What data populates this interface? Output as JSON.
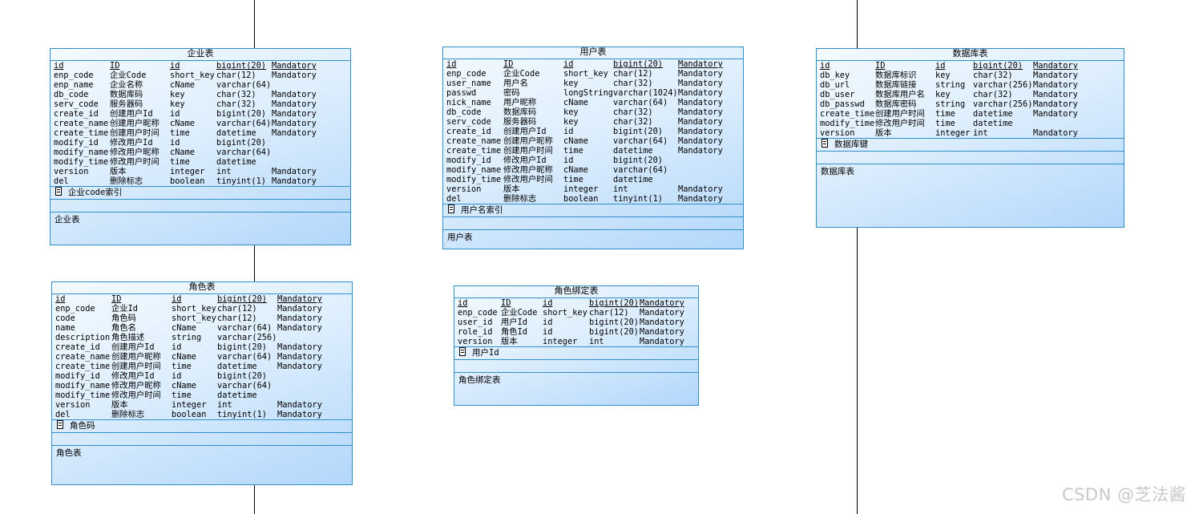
{
  "entities": [
    {
      "key": "enterprise",
      "title": "企业表",
      "header": [
        "id",
        "ID",
        "id",
        "bigint(20)",
        "Mandatory"
      ],
      "rows": [
        [
          "enp_code",
          "企业Code",
          "short_key",
          "char(12)",
          "Mandatory"
        ],
        [
          "enp_name",
          "企业名称",
          "cName",
          "varchar(64)",
          ""
        ],
        [
          "db_code",
          "数据库码",
          "key",
          "char(32)",
          "Mandatory"
        ],
        [
          "serv_code",
          "服务器码",
          "key",
          "char(32)",
          "Mandatory"
        ],
        [
          "create_id",
          "创建用户Id",
          "id",
          "bigint(20)",
          "Mandatory"
        ],
        [
          "create_name",
          "创建用户昵称",
          "cName",
          "varchar(64)",
          "Mandatory"
        ],
        [
          "create_time",
          "创建用户时间",
          "time",
          "datetime",
          "Mandatory"
        ],
        [
          "modify_id",
          "修改用户Id",
          "id",
          "bigint(20)",
          ""
        ],
        [
          "modify_name",
          "修改用户昵称",
          "cName",
          "varchar(64)",
          ""
        ],
        [
          "modify_time",
          "修改用户时间",
          "time",
          "datetime",
          ""
        ],
        [
          "version",
          "版本",
          "integer",
          "int",
          "Mandatory"
        ],
        [
          "del",
          "删除标志",
          "boolean",
          "tinyint(1)",
          "Mandatory"
        ]
      ],
      "index": "企业code索引",
      "comment": "企业表"
    },
    {
      "key": "user",
      "title": "用户表",
      "header": [
        "id",
        "ID",
        "id",
        "bigint(20)",
        "Mandatory"
      ],
      "rows": [
        [
          "enp_code",
          "企业Code",
          "short_key",
          "char(12)",
          "Mandatory"
        ],
        [
          "user_name",
          "用户名",
          "key",
          "char(32)",
          "Mandatory"
        ],
        [
          "passwd",
          "密码",
          "longString",
          "varchar(1024)",
          "Mandatory"
        ],
        [
          "nick_name",
          "用户昵称",
          "cName",
          "varchar(64)",
          "Mandatory"
        ],
        [
          "db_code",
          "数据库码",
          "key",
          "char(32)",
          "Mandatory"
        ],
        [
          "serv_code",
          "服务器码",
          "key",
          "char(32)",
          "Mandatory"
        ],
        [
          "create_id",
          "创建用户Id",
          "id",
          "bigint(20)",
          "Mandatory"
        ],
        [
          "create_name",
          "创建用户昵称",
          "cName",
          "varchar(64)",
          "Mandatory"
        ],
        [
          "create_time",
          "创建用户时间",
          "time",
          "datetime",
          "Mandatory"
        ],
        [
          "modify_id",
          "修改用户Id",
          "id",
          "bigint(20)",
          ""
        ],
        [
          "modify_name",
          "修改用户昵称",
          "cName",
          "varchar(64)",
          ""
        ],
        [
          "modify_time",
          "修改用户时间",
          "time",
          "datetime",
          ""
        ],
        [
          "version",
          "版本",
          "integer",
          "int",
          "Mandatory"
        ],
        [
          "del",
          "删除标志",
          "boolean",
          "tinyint(1)",
          "Mandatory"
        ]
      ],
      "index": "用户名索引",
      "comment": "用户表"
    },
    {
      "key": "database",
      "title": "数据库表",
      "header": [
        "id",
        "ID",
        "id",
        "bigint(20)",
        "Mandatory"
      ],
      "rows": [
        [
          "db_key",
          "数据库标识",
          "key",
          "char(32)",
          "Mandatory"
        ],
        [
          "db_url",
          "数据库链接",
          "string",
          "varchar(256)",
          "Mandatory"
        ],
        [
          "db_user",
          "数据库用户名",
          "key",
          "char(32)",
          "Mandatory"
        ],
        [
          "db_passwd",
          "数据库密码",
          "string",
          "varchar(256)",
          "Mandatory"
        ],
        [
          "create_time",
          "创建用户时间",
          "time",
          "datetime",
          "Mandatory"
        ],
        [
          "modify_time",
          "修改用户时间",
          "time",
          "datetime",
          ""
        ],
        [
          "version",
          "版本",
          "integer",
          "int",
          "Mandatory"
        ]
      ],
      "index": "数据库键",
      "comment": "数据库表"
    },
    {
      "key": "role",
      "title": "角色表",
      "header": [
        "id",
        "ID",
        "id",
        "bigint(20)",
        "Mandatory"
      ],
      "rows": [
        [
          "enp_code",
          "企业Id",
          "short_key",
          "char(12)",
          "Mandatory"
        ],
        [
          "code",
          "角色码",
          "short_key",
          "char(12)",
          "Mandatory"
        ],
        [
          "name",
          "角色名",
          "cName",
          "varchar(64)",
          "Mandatory"
        ],
        [
          "description",
          "角色描述",
          "string",
          "varchar(256)",
          ""
        ],
        [
          "create_id",
          "创建用户Id",
          "id",
          "bigint(20)",
          "Mandatory"
        ],
        [
          "create_name",
          "创建用户昵称",
          "cName",
          "varchar(64)",
          "Mandatory"
        ],
        [
          "create_time",
          "创建用户时间",
          "time",
          "datetime",
          "Mandatory"
        ],
        [
          "modify_id",
          "修改用户Id",
          "id",
          "bigint(20)",
          ""
        ],
        [
          "modify_name",
          "修改用户昵称",
          "cName",
          "varchar(64)",
          ""
        ],
        [
          "modify_time",
          "修改用户时间",
          "time",
          "datetime",
          ""
        ],
        [
          "version",
          "版本",
          "integer",
          "int",
          "Mandatory"
        ],
        [
          "del",
          "删除标志",
          "boolean",
          "tinyint(1)",
          "Mandatory"
        ]
      ],
      "index": "角色码",
      "comment": "角色表"
    },
    {
      "key": "rolebind",
      "title": "角色绑定表",
      "header": [
        "id",
        "ID",
        "id",
        "bigint(20)",
        "Mandatory"
      ],
      "rows": [
        [
          "enp_code",
          "企业Code",
          "short_key",
          "char(12)",
          "Mandatory"
        ],
        [
          "user_id",
          "用户Id",
          "id",
          "bigint(20)",
          "Mandatory"
        ],
        [
          "role_id",
          "角色Id",
          "id",
          "bigint(20)",
          "Mandatory"
        ],
        [
          "version",
          "版本",
          "integer",
          "int",
          "Mandatory"
        ]
      ],
      "index": "用户Id",
      "comment": "角色绑定表"
    }
  ],
  "watermark": "CSDN @芝法酱"
}
